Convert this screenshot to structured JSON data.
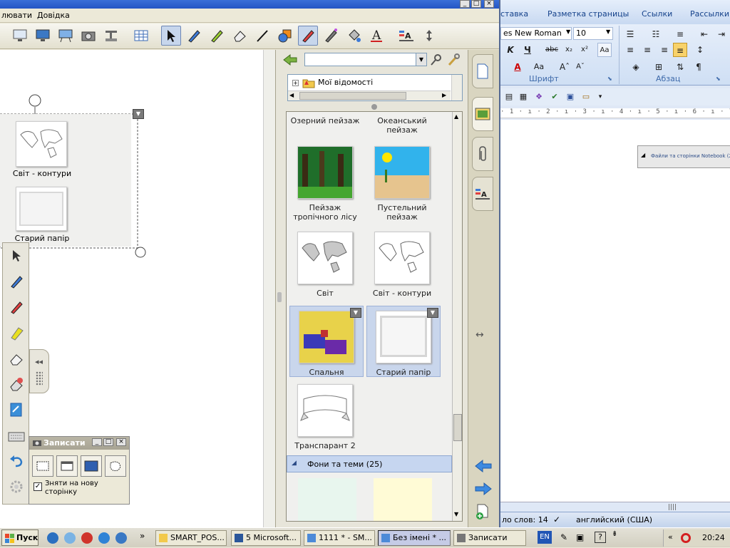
{
  "notebook": {
    "menu": {
      "item1": "лювати",
      "help": "Довідка"
    },
    "pane": {
      "search_value": "",
      "tree_item": "Мої відомості",
      "gallery_items": [
        {
          "label": "Озерний пейзаж"
        },
        {
          "label": "Океанський пейзаж"
        },
        {
          "label": "Пейзаж тропічного лісу"
        },
        {
          "label": "Пустельний пейзаж"
        },
        {
          "label": "Світ"
        },
        {
          "label": "Світ - контури"
        },
        {
          "label": "Спальня"
        },
        {
          "label": "Старий папір"
        },
        {
          "label": "Транспарант 2"
        }
      ],
      "section_header": "Фони та теми (25)"
    },
    "canvas": {
      "items": [
        {
          "label": "Світ - контури"
        },
        {
          "label": "Старий папір"
        }
      ]
    },
    "recorder": {
      "title": "Записати",
      "checkbox_label": "Зняти на нову сторінку",
      "checkbox_checked": true
    }
  },
  "word": {
    "tabs": [
      "ставка",
      "Разметка страницы",
      "Ссылки",
      "Рассылки"
    ],
    "font_name": "es New Roman",
    "font_size": "10",
    "group_font": "Шрифт",
    "group_paragraph": "Абзац",
    "doc_tooltip": "Файли та сторінки Notebook (25",
    "status_words": "ло слов: 14",
    "status_language": "английский (США)"
  },
  "taskbar": {
    "start": "Пуск",
    "tasks": [
      "SMART_POS...",
      "5 Microsoft...",
      "1111 * - SM...",
      "Без імені * ...",
      "Записати"
    ],
    "lang": "EN",
    "time": "20:24"
  },
  "colors": {
    "word_accent": "#15428b",
    "pane_bg": "#e7e5da",
    "selection": "#c9d6ec",
    "section_bar": "#c6d6f0"
  }
}
